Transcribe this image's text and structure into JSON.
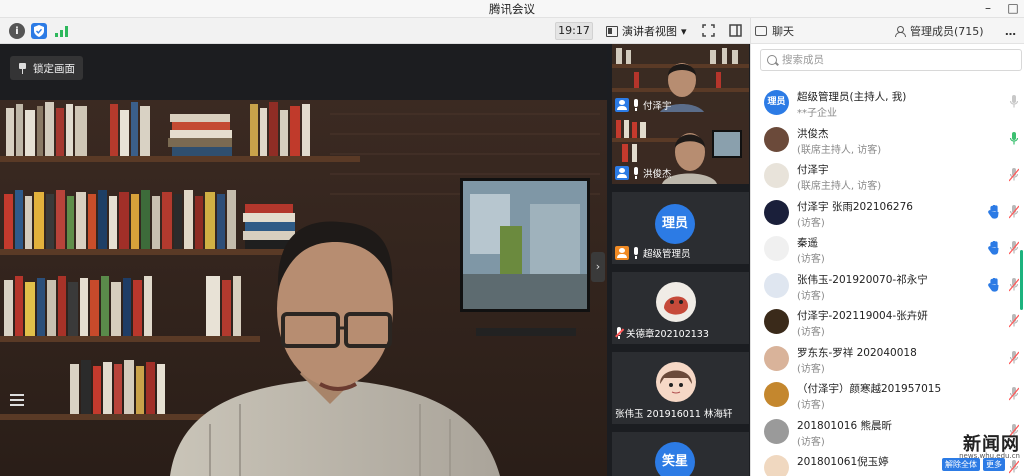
{
  "window": {
    "title": "腾讯会议",
    "controls": [
      "–",
      "□"
    ]
  },
  "toolbar": {
    "time": "19:17",
    "view_label": "演讲者视图",
    "view_caret": "▾",
    "fullscreen": "⛶"
  },
  "main_video": {
    "lock_label": "锁定画面",
    "collapse_arrow": "›"
  },
  "thumbnails": [
    {
      "name": "付泽宇",
      "icon": "user-badge",
      "muted": false,
      "active": false
    },
    {
      "name": "洪俊杰",
      "icon": "user-badge",
      "muted": false,
      "active": true
    },
    {
      "name": "超级管理员",
      "avatar_text": "理员",
      "icon": "user-badge-orange",
      "muted": false,
      "active": false
    },
    {
      "name": "关德章202102133",
      "icon": "none",
      "muted": true,
      "active": false
    },
    {
      "name": "张伟玉 201916011 林海轩",
      "icon": "none",
      "muted": false,
      "active": false
    },
    {
      "name": "",
      "avatar_text": "笑星",
      "icon": "none",
      "muted": false,
      "active": false
    }
  ],
  "panel": {
    "chat_tab": "聊天",
    "members_tab": "管理成员(715)",
    "more": "…",
    "search_placeholder": "搜索成员",
    "members": [
      {
        "name": "超级管理员(主持人, 我)",
        "sub": "**子企业",
        "avatar": "理员",
        "hand": false,
        "mic": "off-gray"
      },
      {
        "name": "洪俊杰",
        "sub": "(联席主持人, 访客)",
        "avatar": "",
        "hand": false,
        "mic": "on-green"
      },
      {
        "name": "付泽宇",
        "sub": "(联席主持人, 访客)",
        "avatar": "",
        "hand": false,
        "mic": "muted"
      },
      {
        "name": "付泽宇 张雨202106276",
        "sub": "(访客)",
        "avatar": "",
        "hand": true,
        "mic": "muted"
      },
      {
        "name": "秦遥",
        "sub": "(访客)",
        "avatar": "",
        "hand": true,
        "mic": "muted"
      },
      {
        "name": "张伟玉-201920070-祁永宁",
        "sub": "(访客)",
        "avatar": "",
        "hand": true,
        "mic": "muted"
      },
      {
        "name": "付泽宇-202119004-张卉妍",
        "sub": "(访客)",
        "avatar": "",
        "hand": false,
        "mic": "muted"
      },
      {
        "name": "罗东东-罗祥 202040018",
        "sub": "(访客)",
        "avatar": "",
        "hand": false,
        "mic": "muted"
      },
      {
        "name": "（付泽宇）颜寒越201957015",
        "sub": "(访客)",
        "avatar": "",
        "hand": false,
        "mic": "muted"
      },
      {
        "name": "201801016 熊晨昕",
        "sub": "(访客)",
        "avatar": "",
        "hand": false,
        "mic": "muted"
      },
      {
        "name": "201801061倪玉婷",
        "sub": "",
        "avatar": "",
        "hand": false,
        "mic": "muted"
      }
    ]
  },
  "watermark": {
    "text": "新闻网",
    "url": "news.whu.edu.cn",
    "btn1": "解除全体",
    "btn2": "更多"
  },
  "colors": {
    "accent_green": "#1cb37e",
    "brand_blue": "#2c7be5",
    "muted_red": "#ff5a5a"
  }
}
